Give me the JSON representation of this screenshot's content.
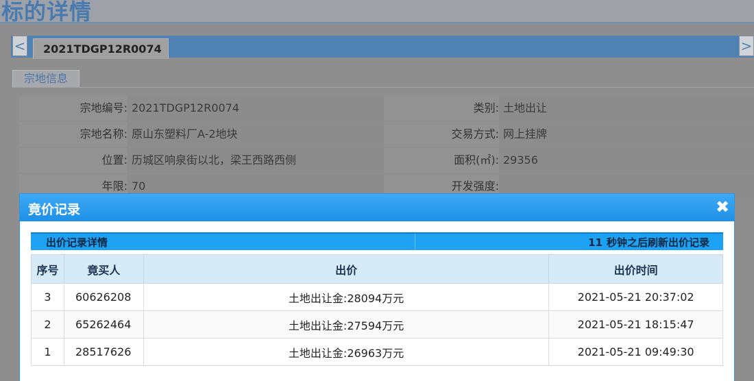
{
  "page": {
    "title": "标的详情",
    "tab_label": "2021TDGP12R0074",
    "arrow_left": "<",
    "arrow_right": ">",
    "section_tab": "宗地信息"
  },
  "info": {
    "rows": [
      {
        "left_label": "宗地编号:",
        "left_value": "2021TDGP12R0074",
        "right_label": "类别:",
        "right_value": "土地出让"
      },
      {
        "left_label": "宗地名称:",
        "left_value": "原山东塑料厂A-2地块",
        "right_label": "交易方式:",
        "right_value": "网上挂牌"
      },
      {
        "left_label": "位置:",
        "left_value": "历城区响泉街以北，梁王西路西侧",
        "right_label": "面积(㎡):",
        "right_value": "29356"
      },
      {
        "left_label": "年限:",
        "left_value": "70",
        "right_label": "开发强度:",
        "right_value": ""
      }
    ]
  },
  "modal": {
    "title": "竟价记录",
    "close": "✖",
    "bar_left": "出价记录详情",
    "bar_count": "11",
    "bar_right": "秒钟之后刷新出价记录",
    "columns": [
      "序号",
      "竟买人",
      "出价",
      "出价时间"
    ],
    "rows": [
      {
        "seq": "3",
        "buyer": "60626208",
        "price": "土地出让金:28094万元",
        "time": "2021-05-21 20:37:02"
      },
      {
        "seq": "2",
        "buyer": "65262464",
        "price": "土地出让金:27594万元",
        "time": "2021-05-21 18:15:47"
      },
      {
        "seq": "1",
        "buyer": "28517626",
        "price": "土地出让金:26963万元",
        "time": "2021-05-21 09:49:30"
      }
    ]
  },
  "colors": {
    "modal_header": "#1e90e6",
    "bar": "#1da1f2",
    "table_header": "#d6eaf8",
    "tab_strip": "#4f82b3"
  }
}
